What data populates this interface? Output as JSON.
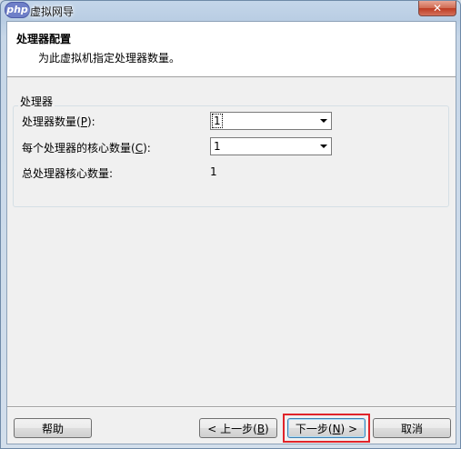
{
  "window": {
    "logo_text": "php",
    "title": "虚拟网导",
    "close_glyph": "✕"
  },
  "header": {
    "title": "处理器配置",
    "subtitle": "为此虚拟机指定处理器数量。"
  },
  "processor_group": {
    "legend": "处理器",
    "processor_count_label_pre": "处理器数量(",
    "processor_count_label_key": "P",
    "processor_count_label_post": "):",
    "processor_count_value": "1",
    "cores_label_pre": "每个处理器的核心数量(",
    "cores_label_key": "C",
    "cores_label_post": "):",
    "cores_value": "1",
    "total_cores_label": "总处理器核心数量:",
    "total_cores_value": "1"
  },
  "footer": {
    "help_label": "帮助",
    "back_pre": "< 上一步(",
    "back_key": "B",
    "back_post": ")",
    "next_pre": "下一步(",
    "next_key": "N",
    "next_post": ") >",
    "cancel_label": "取消"
  },
  "colors": {
    "highlight_border": "#e0242a",
    "window_frame": "#b9cde3"
  }
}
